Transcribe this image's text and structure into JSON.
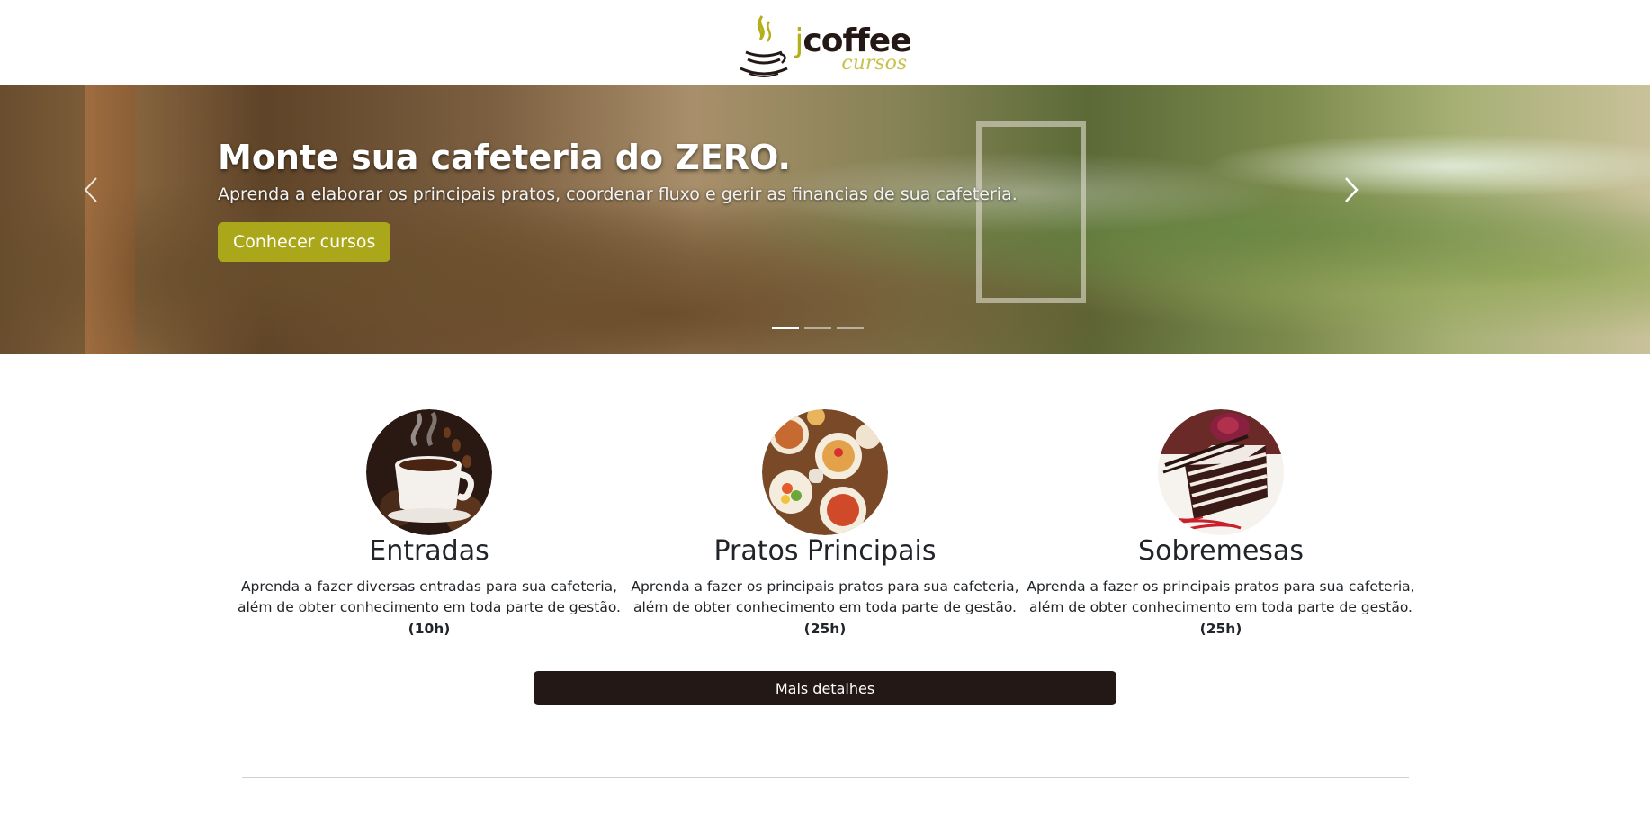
{
  "header": {
    "logo_j": "j",
    "logo_main": "coffee",
    "logo_sub": "cursos"
  },
  "hero": {
    "title": "Monte sua cafeteria do ZERO.",
    "subtitle": "Aprenda a elaborar os principais pratos, coordenar fluxo e gerir as financias de sua cafeteria.",
    "cta_label": "Conhecer cursos",
    "slides_count": 3,
    "active_slide": 1,
    "prev_icon": "chevron-left-icon",
    "next_icon": "chevron-right-icon"
  },
  "courses": [
    {
      "name": "Entradas",
      "desc_line1": "Aprenda a fazer diversas entradas para sua cafeteria,",
      "desc_line2": "além de obter conhecimento em toda parte de gestão.",
      "hours": "(10h)"
    },
    {
      "name": "Pratos Principais",
      "desc_line1": "Aprenda a fazer os principais pratos para sua cafeteria,",
      "desc_line2": "além de obter conhecimento em toda parte de gestão.",
      "hours": "(25h)"
    },
    {
      "name": "Sobremesas",
      "desc_line1": "Aprenda a fazer os principais pratos para sua cafeteria,",
      "desc_line2": "além de obter conhecimento em toda parte de gestão.",
      "hours": "(25h)"
    }
  ],
  "details_button": "Mais detalhes",
  "colors": {
    "brand_olive": "#aaa81a",
    "brand_dark": "#231815"
  }
}
